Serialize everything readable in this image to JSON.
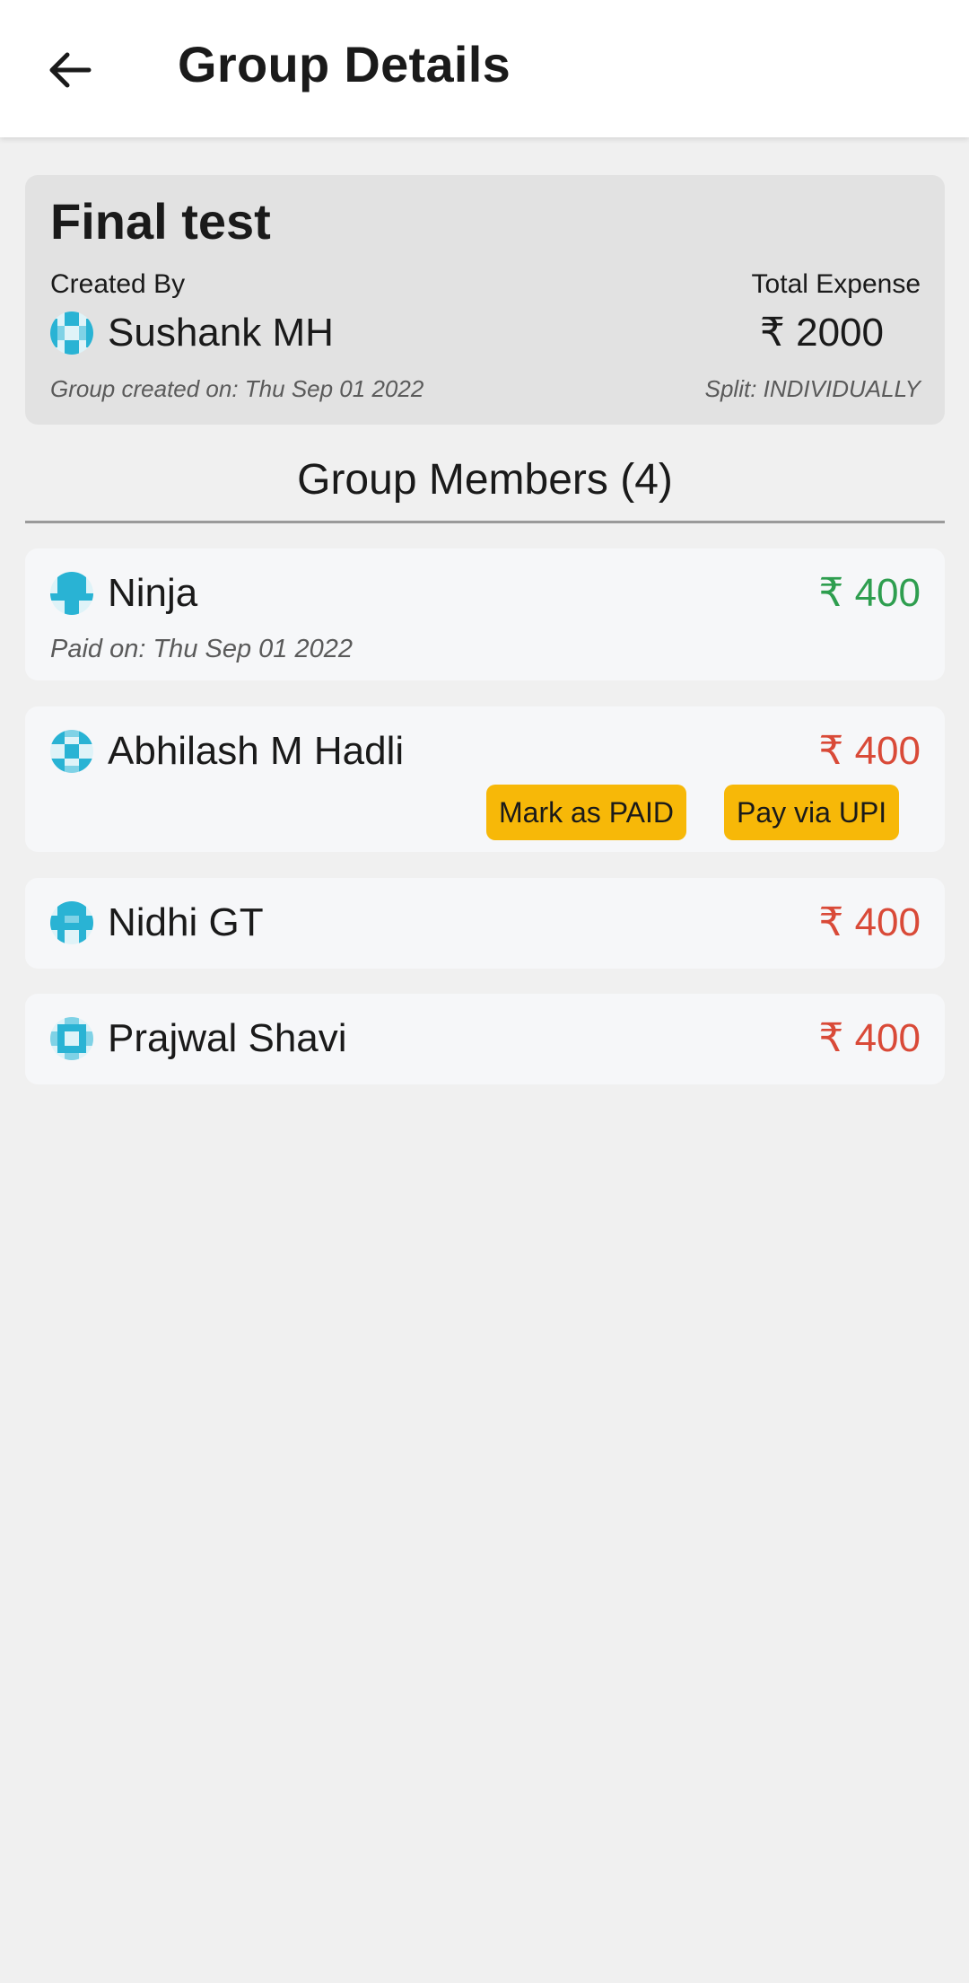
{
  "appbar": {
    "title": "Group Details",
    "back_icon": "arrow-left-icon"
  },
  "group": {
    "name": "Final test",
    "created_by_label": "Created By",
    "creator_name": "Sushank MH",
    "total_expense_label": "Total Expense",
    "total_expense": "₹ 2000",
    "created_on": "Group created on: Thu Sep 01 2022",
    "split": "Split: INDIVIDUALLY"
  },
  "members_section": {
    "heading": "Group Members (4)"
  },
  "members": [
    {
      "name": "Ninja",
      "amount": "₹ 400",
      "status": "paid",
      "paid_on": "Paid on: Thu Sep 01 2022"
    },
    {
      "name": "Abhilash M Hadli",
      "amount": "₹ 400",
      "status": "unpaid",
      "mark_paid_label": "Mark as PAID",
      "pay_upi_label": "Pay via UPI"
    },
    {
      "name": "Nidhi GT",
      "amount": "₹ 400",
      "status": "unpaid"
    },
    {
      "name": "Prajwal Shavi",
      "amount": "₹ 400",
      "status": "unpaid"
    }
  ],
  "colors": {
    "paid": "#2e9e4f",
    "unpaid": "#d94a38",
    "button": "#f7b808",
    "avatar_accent": "#29b3d4"
  }
}
